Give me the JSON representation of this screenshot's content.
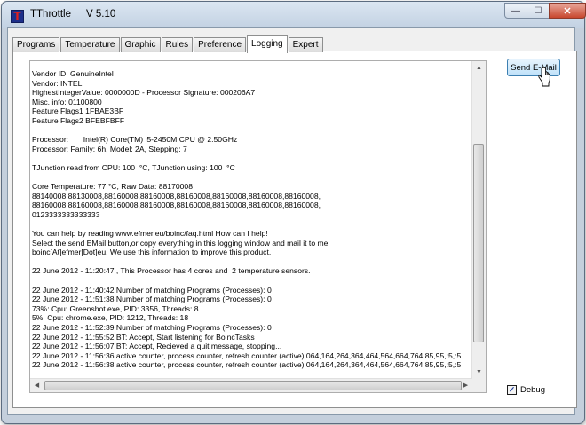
{
  "window": {
    "title": "TThrottle",
    "version": "V 5.10",
    "app_icon_letter": "T",
    "controls": {
      "minimize": "—",
      "maximize": "☐",
      "close": "✕"
    }
  },
  "tabs": [
    {
      "label": "Programs",
      "active": false
    },
    {
      "label": "Temperature",
      "active": false
    },
    {
      "label": "Graphic",
      "active": false
    },
    {
      "label": "Rules",
      "active": false
    },
    {
      "label": "Preference",
      "active": false
    },
    {
      "label": "Logging",
      "active": true
    },
    {
      "label": "Expert",
      "active": false
    }
  ],
  "log_lines": [
    "Vendor ID: GenuineIntel",
    "Vendor: INTEL",
    "HighestIntegerValue: 0000000D - Processor Signature: 000206A7",
    "Misc. info: 01100800",
    "Feature Flags1 1FBAE3BF",
    "Feature Flags2 BFEBFBFF",
    "",
    "Processor:       Intel(R) Core(TM) i5-2450M CPU @ 2.50GHz",
    "Processor: Family: 6h, Model: 2A, Stepping: 7",
    "",
    "TJunction read from CPU: 100  °C, TJunction using: 100  °C",
    "",
    "Core Temperature: 77 °C, Raw Data: 88170008",
    "88140008,88130008,88160008,88160008,88160008,88160008,88160008,88160008,",
    "88160008,88160008,88160008,88160008,88160008,88160008,88160008,88160008,",
    "0123333333333333",
    "",
    "You can help by reading www.efmer.eu/boinc/faq.html How can I help!",
    "Select the send EMail button,or copy everything in this logging window and mail it to me!",
    "boinc[At]efmer[Dot]eu. We use this information to improve this product.",
    "",
    "22 June 2012 - 11:20:47 , This Processor has 4 cores and  2 temperature sensors.",
    "",
    "22 June 2012 - 11:40:42 Number of matching Programs (Processes): 0",
    "22 June 2012 - 11:51:38 Number of matching Programs (Processes): 0",
    "73%: Cpu: Greenshot.exe, PID: 3356, Threads: 8",
    "5%: Cpu: chrome.exe, PID: 1212, Threads: 18",
    "22 June 2012 - 11:52:39 Number of matching Programs (Processes): 0",
    "22 June 2012 - 11:55:52 BT: Accept, Start listening for BoincTasks",
    "22 June 2012 - 11:56:07 BT: Accept, Recieved a quit message, stopping...",
    "22 June 2012 - 11:56:36 active counter, process counter, refresh counter (active) 064,164,264,364,464,564,664,764,85,95,:5,:5",
    "22 June 2012 - 11:56:38 active counter, process counter, refresh counter (active) 064,164,264,364,464,564,664,764,85,95,:5,:5"
  ],
  "send_button": {
    "label": "Send E-Mail"
  },
  "debug": {
    "label": "Debug",
    "checked": true,
    "check_glyph": "✓"
  },
  "colors": {
    "accent_button": "#bfe1f9",
    "close_button": "#c8472e"
  }
}
